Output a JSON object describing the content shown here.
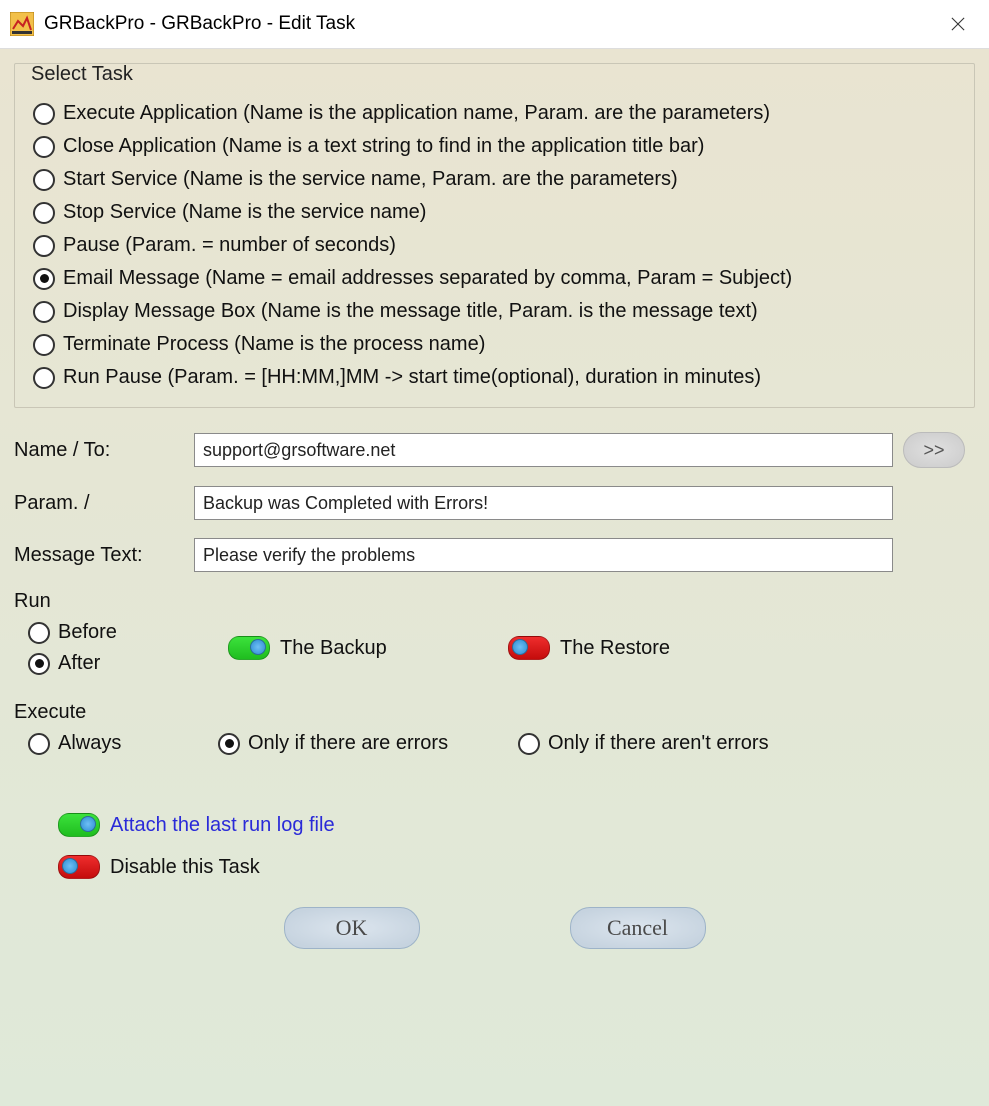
{
  "window": {
    "title": "GRBackPro - GRBackPro - Edit Task"
  },
  "selectTask": {
    "legend": "Select Task",
    "options": [
      "Execute Application (Name is the application name, Param. are the parameters)",
      "Close Application (Name is a text string to find in the application title bar)",
      "Start Service  (Name is the service name, Param. are the parameters)",
      "Stop Service  (Name is the service name)",
      "Pause  (Param. = number of seconds)",
      "Email Message (Name = email addresses separated by comma, Param =  Subject)",
      "Display Message Box (Name is the message title, Param. is the message text)",
      "Terminate Process (Name is the process name)",
      "Run Pause (Param. = [HH:MM,]MM -> start time(optional), duration in minutes)"
    ],
    "selectedIndex": 5
  },
  "form": {
    "name_label": "Name / To:",
    "name_value": "support@grsoftware.net",
    "param_label": "Param. /",
    "param_value": "Backup was Completed with Errors!",
    "msg_label": "Message Text:",
    "msg_value": "Please verify the problems",
    "browse_label": ">>"
  },
  "run": {
    "legend": "Run",
    "before_label": "Before",
    "after_label": "After",
    "before_after_selected": "After",
    "backup_label": "The Backup",
    "backup_state": "on",
    "restore_label": "The Restore",
    "restore_state": "off"
  },
  "execute": {
    "legend": "Execute",
    "options": [
      "Always",
      "Only if there are errors",
      "Only if there aren't errors"
    ],
    "selectedIndex": 1
  },
  "attach": {
    "label": "Attach the last run log file",
    "state": "on"
  },
  "disable": {
    "label": "Disable this Task",
    "state": "off"
  },
  "buttons": {
    "ok": "OK",
    "cancel": "Cancel"
  }
}
